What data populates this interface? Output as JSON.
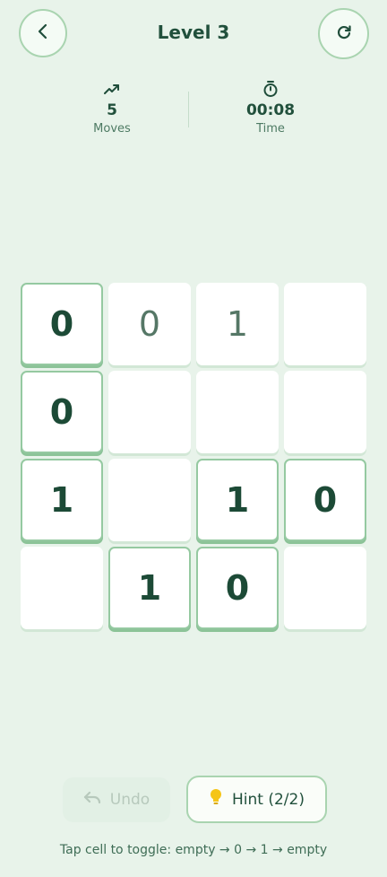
{
  "header": {
    "title": "Level 3",
    "back_icon": "chevron-left-icon",
    "restart_icon": "refresh-icon"
  },
  "stats": {
    "moves": {
      "icon": "trend-up-icon",
      "value": "5",
      "label": "Moves"
    },
    "time": {
      "icon": "stopwatch-icon",
      "value": "00:08",
      "label": "Time"
    }
  },
  "board": {
    "rows": [
      [
        {
          "value": "0",
          "kind": "fixed"
        },
        {
          "value": "0",
          "kind": "user"
        },
        {
          "value": "1",
          "kind": "user"
        },
        {
          "value": "",
          "kind": "empty"
        }
      ],
      [
        {
          "value": "0",
          "kind": "fixed"
        },
        {
          "value": "",
          "kind": "empty"
        },
        {
          "value": "",
          "kind": "empty"
        },
        {
          "value": "",
          "kind": "empty"
        }
      ],
      [
        {
          "value": "1",
          "kind": "fixed"
        },
        {
          "value": "",
          "kind": "empty"
        },
        {
          "value": "1",
          "kind": "fixed"
        },
        {
          "value": "0",
          "kind": "fixed"
        }
      ],
      [
        {
          "value": "",
          "kind": "empty"
        },
        {
          "value": "1",
          "kind": "fixed"
        },
        {
          "value": "0",
          "kind": "fixed"
        },
        {
          "value": "",
          "kind": "empty"
        }
      ]
    ]
  },
  "controls": {
    "undo_label": "Undo",
    "undo_icon": "undo-icon",
    "hint_label": "Hint (2/2)",
    "hint_icon": "lightbulb-icon"
  },
  "footer": {
    "instruction": "Tap cell to toggle: empty → 0 → 1 → empty"
  },
  "colors": {
    "background": "#e8f3ea",
    "accent": "#1f4d3a",
    "border": "#a9d4b0",
    "hint_bulb": "#f5c518"
  }
}
